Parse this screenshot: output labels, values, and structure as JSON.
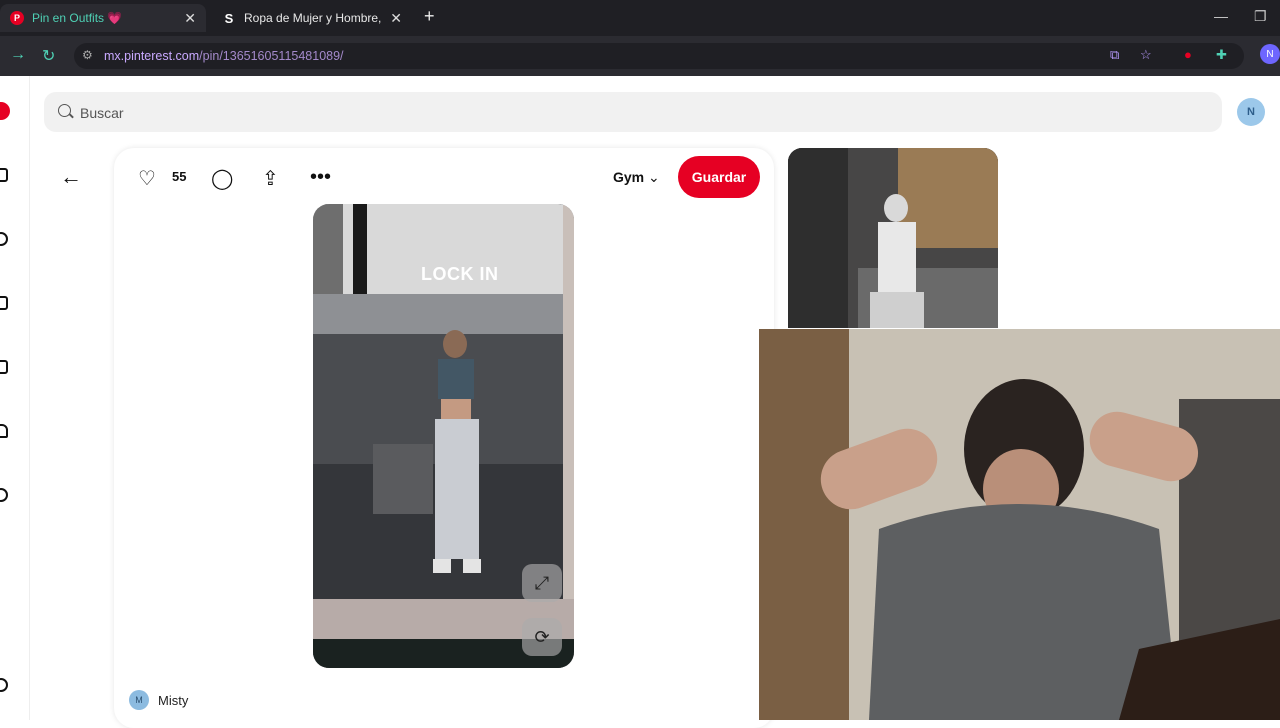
{
  "browser": {
    "tabs": [
      {
        "title": "Pin en Outfits 💗",
        "active": true
      },
      {
        "title": "Ropa de Mujer y Hombre, Com",
        "active": false
      }
    ],
    "url_domain": "mx.pinterest.com",
    "url_path": "/pin/136516051154810​89/",
    "profile_initial": "N"
  },
  "search": {
    "placeholder": "Buscar"
  },
  "user": {
    "avatar_initial": "N"
  },
  "pin": {
    "like_count": "55",
    "board_name": "Gym",
    "save_label": "Guardar",
    "image_caption": "LOCK IN",
    "author_initial": "M",
    "author_name": "Misty"
  },
  "colors": {
    "brand": "#e60023",
    "tabbar": "#1f1f24",
    "accent_url": "#b89cff"
  }
}
